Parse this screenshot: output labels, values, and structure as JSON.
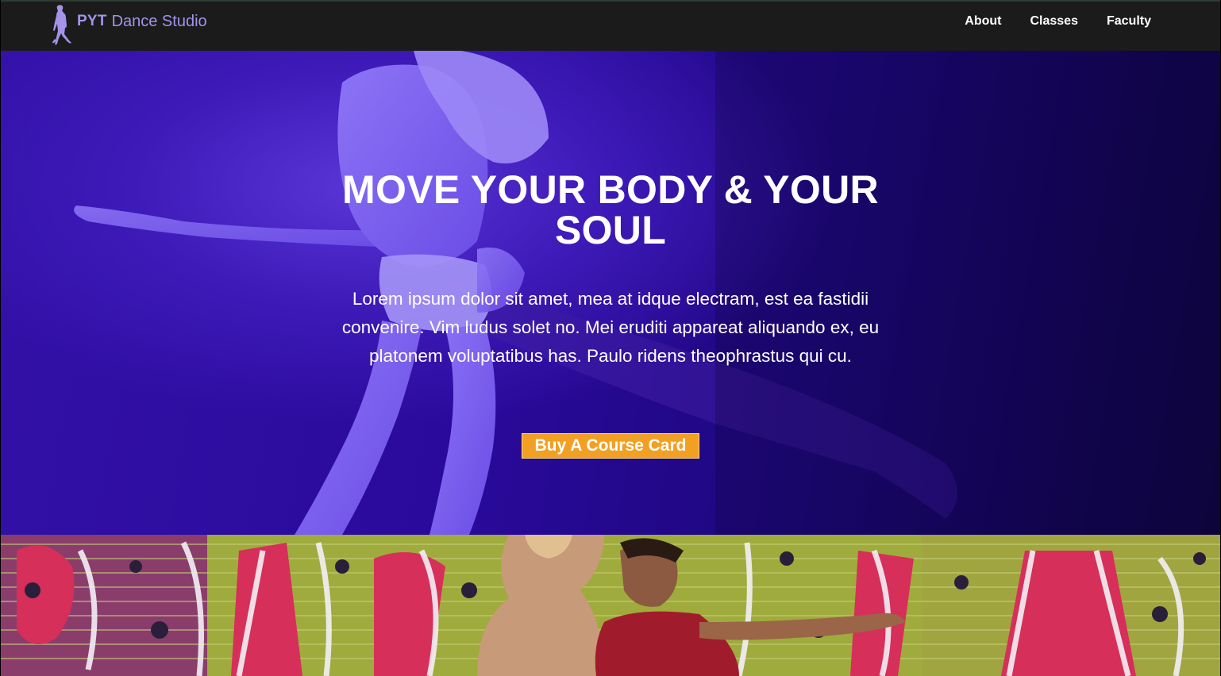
{
  "header": {
    "brand_bold": "PYT",
    "brand_light": "Dance Studio",
    "logo_icon": "dancer-silhouette-icon",
    "nav": [
      {
        "label": "About"
      },
      {
        "label": "Classes"
      },
      {
        "label": "Faculty"
      }
    ]
  },
  "hero": {
    "title": "MOVE YOUR BODY & YOUR SOUL",
    "text": "Lorem ipsum dolor sit amet, mea at idque electram, est ea fastidii convenire. Vim ludus solet no. Mei eruditi appareat aliquando ex, eu platonem voluptatibus has. Paulo ridens theophrastus qui cu.",
    "cta_label": "Buy A Course Card",
    "image": "dancing-couple-photo"
  },
  "second_section": {
    "image": "graffiti-wall-dancers-photo"
  },
  "colors": {
    "navbar_bg": "#1b1b1b",
    "brand": "#a493e9",
    "hero_overlay": "#2a0a9c",
    "cta_bg": "#f2a024",
    "text": "#ffffff"
  }
}
